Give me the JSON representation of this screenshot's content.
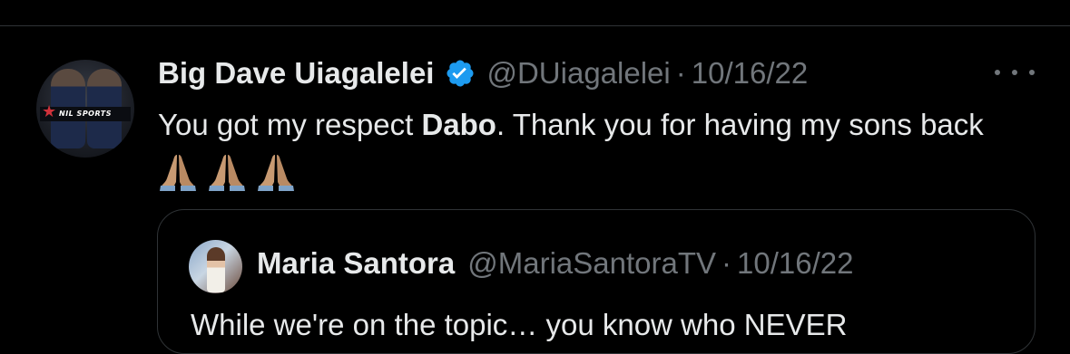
{
  "tweet": {
    "author_name": "Big Dave Uiagalelei",
    "handle": "@DUiagalelei",
    "separator": "·",
    "date": "10/16/22",
    "verified": true,
    "text_before": "You got my respect ",
    "text_bold": "Dabo",
    "text_after": ". Thank you for having my sons back",
    "emoji": [
      "folded-hands",
      "folded-hands",
      "folded-hands"
    ],
    "avatar_banner": "NIL SPORTS"
  },
  "quoted_tweet": {
    "author_name": "Maria Santora",
    "handle": "@MariaSantoraTV",
    "separator": "·",
    "date": "10/16/22",
    "text": "While we're on the topic… you know who NEVER"
  },
  "colors": {
    "background": "#000000",
    "primary_text": "#e7e9ea",
    "secondary_text": "#71767b",
    "border": "#2f3336",
    "verified_blue": "#1d9bf0"
  },
  "icons": {
    "verified": "verified-badge-icon",
    "more": "more-options-icon",
    "emoji": "folded-hands-emoji"
  }
}
